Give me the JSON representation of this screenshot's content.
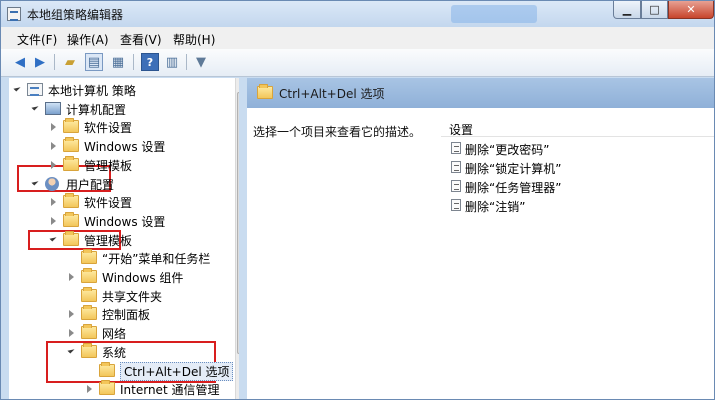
{
  "window": {
    "title": "本地组策略编辑器"
  },
  "menu": [
    "文件(F)",
    "操作(A)",
    "查看(V)",
    "帮助(H)"
  ],
  "toolbar_icons": [
    "back-arrow-icon",
    "forward-arrow-icon",
    "up-folder-icon",
    "show-hide-tree-icon",
    "view-list-icon",
    "help-icon",
    "properties-icon",
    "filter-icon"
  ],
  "tree": [
    {
      "label": "本地计算机 策略",
      "indent": 0,
      "exp": "open",
      "icon": "policy"
    },
    {
      "label": "计算机配置",
      "indent": 1,
      "exp": "open",
      "icon": "pc"
    },
    {
      "label": "软件设置",
      "indent": 2,
      "exp": "closed",
      "icon": "folder"
    },
    {
      "label": "Windows 设置",
      "indent": 2,
      "exp": "closed",
      "icon": "folder"
    },
    {
      "label": "管理模板",
      "indent": 2,
      "exp": "closed",
      "icon": "folder"
    },
    {
      "label": "用户配置",
      "indent": 1,
      "exp": "open",
      "icon": "user"
    },
    {
      "label": "软件设置",
      "indent": 2,
      "exp": "closed",
      "icon": "folder"
    },
    {
      "label": "Windows 设置",
      "indent": 2,
      "exp": "closed",
      "icon": "folder"
    },
    {
      "label": "管理模板",
      "indent": 2,
      "exp": "open",
      "icon": "folder"
    },
    {
      "label": "“开始”菜单和任务栏",
      "indent": 3,
      "exp": "none",
      "icon": "folder"
    },
    {
      "label": "Windows 组件",
      "indent": 3,
      "exp": "closed",
      "icon": "folder"
    },
    {
      "label": "共享文件夹",
      "indent": 3,
      "exp": "none",
      "icon": "folder"
    },
    {
      "label": "控制面板",
      "indent": 3,
      "exp": "closed",
      "icon": "folder"
    },
    {
      "label": "网络",
      "indent": 3,
      "exp": "closed",
      "icon": "folder"
    },
    {
      "label": "系统",
      "indent": 3,
      "exp": "open",
      "icon": "folder"
    },
    {
      "label": "Ctrl+Alt+Del 选项",
      "indent": 4,
      "exp": "none",
      "icon": "folder",
      "selected": true
    },
    {
      "label": "Internet 通信管理",
      "indent": 4,
      "exp": "closed",
      "icon": "folder"
    }
  ],
  "right": {
    "title": "Ctrl+Alt+Del 选项",
    "description": "选择一个项目来查看它的描述。",
    "settings_header": "设置",
    "settings": [
      "删除“更改密码”",
      "删除“锁定计算机”",
      "删除“任务管理器”",
      "删除“注销”"
    ]
  }
}
